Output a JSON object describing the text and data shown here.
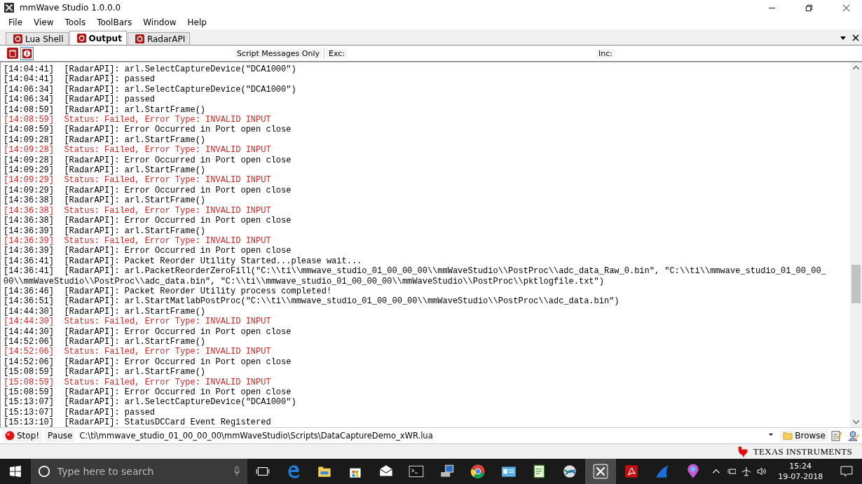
{
  "window": {
    "title": "mmWave Studio 1.0.0.0"
  },
  "menu": [
    {
      "label": "File"
    },
    {
      "label": "View"
    },
    {
      "label": "Tools"
    },
    {
      "label": "ToolBars"
    },
    {
      "label": "Window"
    },
    {
      "label": "Help"
    }
  ],
  "tabs": [
    {
      "label": "Lua Shell",
      "selected": false
    },
    {
      "label": "Output",
      "selected": true
    },
    {
      "label": "RadarAPI",
      "selected": false
    }
  ],
  "toolbar": {
    "filter_label": "Script Messages Only",
    "exclude_label": "Exc:",
    "include_label": "Inc:"
  },
  "log": [
    {
      "time": "[14:04:41]",
      "text": "[RadarAPI]: arl.SelectCaptureDevice(\"DCA1000\")",
      "kind": "info"
    },
    {
      "time": "[14:04:41]",
      "text": "[RadarAPI]: passed",
      "kind": "info"
    },
    {
      "time": "[14:06:34]",
      "text": "[RadarAPI]: arl.SelectCaptureDevice(\"DCA1000\")",
      "kind": "info"
    },
    {
      "time": "[14:06:34]",
      "text": "[RadarAPI]: passed",
      "kind": "info"
    },
    {
      "time": "[14:08:59]",
      "text": "[RadarAPI]: arl.StartFrame()",
      "kind": "info"
    },
    {
      "time": "[14:08:59]",
      "text": "Status: Failed, Error Type: INVALID INPUT",
      "kind": "error"
    },
    {
      "time": "[14:08:59]",
      "text": "[RadarAPI]: Error Occurred in Port open close",
      "kind": "info"
    },
    {
      "time": "[14:09:28]",
      "text": "[RadarAPI]: arl.StartFrame()",
      "kind": "info"
    },
    {
      "time": "[14:09:28]",
      "text": "Status: Failed, Error Type: INVALID INPUT",
      "kind": "error"
    },
    {
      "time": "[14:09:28]",
      "text": "[RadarAPI]: Error Occurred in Port open close",
      "kind": "info"
    },
    {
      "time": "[14:09:29]",
      "text": "[RadarAPI]: arl.StartFrame()",
      "kind": "info"
    },
    {
      "time": "[14:09:29]",
      "text": "Status: Failed, Error Type: INVALID INPUT",
      "kind": "error"
    },
    {
      "time": "[14:09:29]",
      "text": "[RadarAPI]: Error Occurred in Port open close",
      "kind": "info"
    },
    {
      "time": "[14:36:38]",
      "text": "[RadarAPI]: arl.StartFrame()",
      "kind": "info"
    },
    {
      "time": "[14:36:38]",
      "text": "Status: Failed, Error Type: INVALID INPUT",
      "kind": "error"
    },
    {
      "time": "[14:36:38]",
      "text": "[RadarAPI]: Error Occurred in Port open close",
      "kind": "info"
    },
    {
      "time": "[14:36:39]",
      "text": "[RadarAPI]: arl.StartFrame()",
      "kind": "info"
    },
    {
      "time": "[14:36:39]",
      "text": "Status: Failed, Error Type: INVALID INPUT",
      "kind": "error"
    },
    {
      "time": "[14:36:39]",
      "text": "[RadarAPI]: Error Occurred in Port open close",
      "kind": "info"
    },
    {
      "time": "[14:36:41]",
      "text": "[RadarAPI]: Packet Reorder Utility Started...please wait...",
      "kind": "info"
    },
    {
      "time": "[14:36:41]",
      "text": "[RadarAPI]: arl.PacketReorderZeroFill(\"C:\\\\ti\\\\mmwave_studio_01_00_00_00\\\\mmWaveStudio\\\\PostProc\\\\adc_data_Raw_0.bin\", \"C:\\\\ti\\\\mmwave_studio_01_00_00_00\\\\mmWaveStudio\\\\PostProc\\\\adc_data.bin\", \"C:\\\\ti\\\\mmwave_studio_01_00_00_00\\\\mmWaveStudio\\\\PostProc\\\\pktlogfile.txt\")",
      "kind": "info"
    },
    {
      "time": "[14:36:46]",
      "text": "[RadarAPI]: Packet Reorder Utility process completed!",
      "kind": "info"
    },
    {
      "time": "[14:36:51]",
      "text": "[RadarAPI]: arl.StartMatlabPostProc(\"C:\\\\ti\\\\mmwave_studio_01_00_00_00\\\\mmWaveStudio\\\\PostProc\\\\adc_data.bin\")",
      "kind": "info"
    },
    {
      "time": "[14:44:30]",
      "text": "[RadarAPI]: arl.StartFrame()",
      "kind": "info"
    },
    {
      "time": "[14:44:30]",
      "text": "Status: Failed, Error Type: INVALID INPUT",
      "kind": "error"
    },
    {
      "time": "[14:44:30]",
      "text": "[RadarAPI]: Error Occurred in Port open close",
      "kind": "info"
    },
    {
      "time": "[14:52:06]",
      "text": "[RadarAPI]: arl.StartFrame()",
      "kind": "info"
    },
    {
      "time": "[14:52:06]",
      "text": "Status: Failed, Error Type: INVALID INPUT",
      "kind": "error"
    },
    {
      "time": "[14:52:06]",
      "text": "[RadarAPI]: Error Occurred in Port open close",
      "kind": "info"
    },
    {
      "time": "[15:08:59]",
      "text": "[RadarAPI]: arl.StartFrame()",
      "kind": "info"
    },
    {
      "time": "[15:08:59]",
      "text": "Status: Failed, Error Type: INVALID INPUT",
      "kind": "error"
    },
    {
      "time": "[15:08:59]",
      "text": "[RadarAPI]: Error Occurred in Port open close",
      "kind": "info"
    },
    {
      "time": "[15:13:07]",
      "text": "[RadarAPI]: arl.SelectCaptureDevice(\"DCA1000\")",
      "kind": "info"
    },
    {
      "time": "[15:13:07]",
      "text": "[RadarAPI]: passed",
      "kind": "info"
    },
    {
      "time": "[15:13:10]",
      "text": "[RadarAPI]: StatusDCCard Event Registered",
      "kind": "info"
    }
  ],
  "command_bar": {
    "stop_label": "Stop!",
    "pause_label": "Pause",
    "script_path": "C:\\ti\\mmwave_studio_01_00_00_00\\mmWaveStudio\\Scripts\\DataCaptureDemo_xWR.lua",
    "browse_label": "Browse"
  },
  "branding": {
    "logo_text": "TEXAS INSTRUMENTS"
  },
  "taskbar": {
    "search_placeholder": "Type here to search",
    "time": "15:24",
    "date": "19-07-2018"
  }
}
